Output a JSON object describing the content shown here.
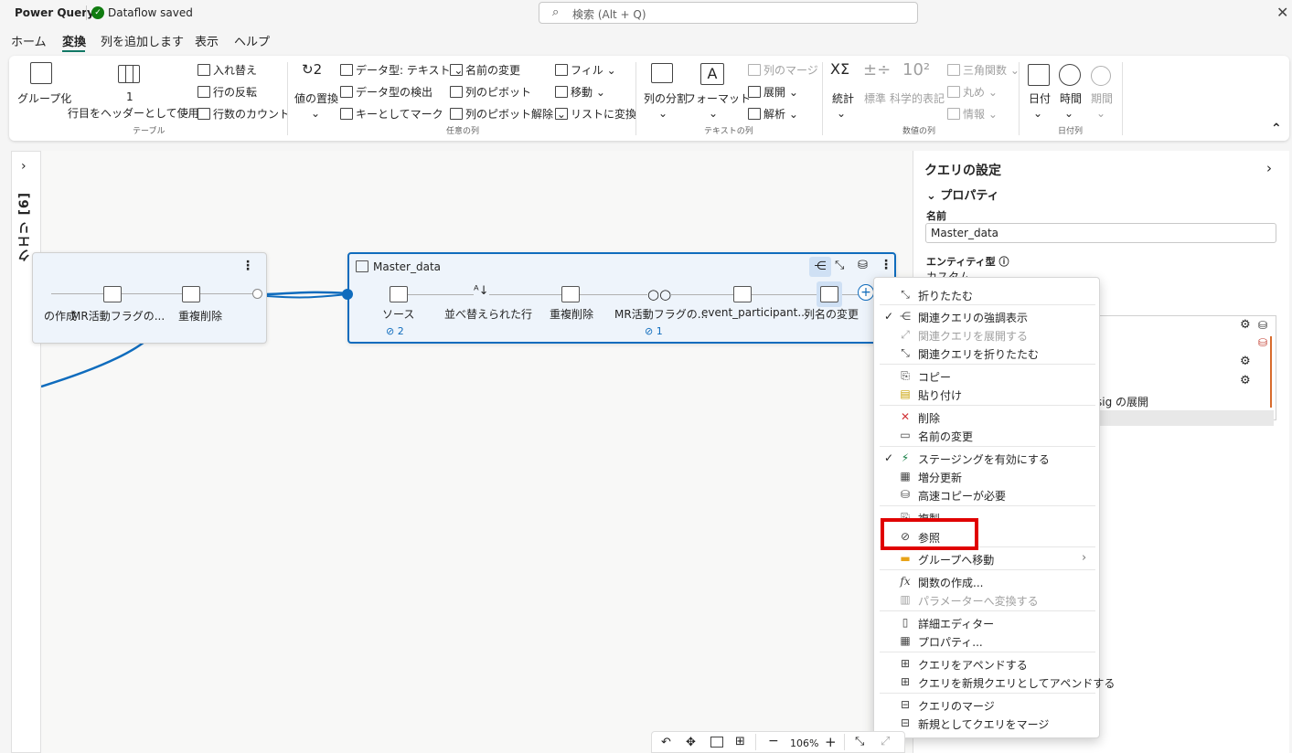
{
  "titlebar": {
    "app_title": "Power Query",
    "saved_text": "Dataflow saved",
    "search_placeholder": "検索 (Alt + Q)",
    "close": "✕"
  },
  "tabs": [
    "ホーム",
    "変換",
    "列を追加します",
    "表示",
    "ヘルプ"
  ],
  "active_tab": "変換",
  "ribbon": {
    "groups": {
      "table": "テーブル",
      "any_column": "任意の列",
      "text_column": "テキストの列",
      "number_column": "数値の列",
      "datetime": "日付列"
    },
    "group_by": "グループ化",
    "use_first_row_1": "1",
    "use_first_row_2": "行目をヘッダーとして使用",
    "transpose": "入れ替え",
    "reverse_rows": "行の反転",
    "count_rows": "行数のカウント",
    "replace_values": "値の置換",
    "data_type": "データ型: テキスト",
    "detect_type": "データ型の検出",
    "mark_as_key": "キーとしてマーク",
    "rename": "名前の変更",
    "pivot": "列のピボット",
    "unpivot": "列のピボット解除",
    "fill": "フィル",
    "move": "移動",
    "to_list": "リストに変換",
    "split_column": "列の分割",
    "format": "フォーマット",
    "merge_columns": "列のマージ",
    "expand": "展開",
    "parse": "解析",
    "statistics": "統計",
    "standard": "標準",
    "scientific": "科学的表記",
    "trigonometry": "三角関数",
    "rounding": "丸め",
    "information": "情報",
    "date": "日付",
    "time": "時間",
    "duration": "期間"
  },
  "query_pane": {
    "label": "クエリ [6]",
    "chevron": "›"
  },
  "diagram": {
    "left_card": {
      "steps": [
        "の作成",
        "MR活動フラグの...",
        "重複削除"
      ]
    },
    "main_card": {
      "title": "Master_data",
      "steps": [
        "ソース",
        "並べ替えられた行",
        "重複削除",
        "MR活動フラグの...",
        "event_participant...",
        "列名の変更"
      ],
      "link_count_1": "2",
      "link_count_2": "1"
    }
  },
  "settings": {
    "title": "クエリの設定",
    "properties": "プロパティ",
    "name_label": "名前",
    "name_value": "Master_data",
    "entity_type_label": "エンティティ型",
    "entity_type_value": "カスタム",
    "partial_text": "sig の展開"
  },
  "context_menu": {
    "collapse": "折りたたむ",
    "highlight_related": "関連クエリの強調表示",
    "expand_related": "関連クエリを展開する",
    "collapse_related": "関連クエリを折りたたむ",
    "copy": "コピー",
    "paste": "貼り付け",
    "delete": "削除",
    "rename": "名前の変更",
    "enable_staging": "ステージングを有効にする",
    "incremental_refresh": "増分更新",
    "fast_copy": "高速コピーが必要",
    "duplicate": "複製",
    "reference": "参照",
    "move_to_group": "グループへ移動",
    "create_function": "関数の作成...",
    "convert_to_parameter": "パラメーターへ変換する",
    "advanced_editor": "詳細エディター",
    "properties": "プロパティ...",
    "append_queries": "クエリをアペンドする",
    "append_as_new": "クエリを新規クエリとしてアペンドする",
    "merge_queries": "クエリのマージ",
    "merge_as_new": "新規としてクエリをマージ"
  },
  "bottom_toolbar": {
    "zoom": "106%"
  }
}
